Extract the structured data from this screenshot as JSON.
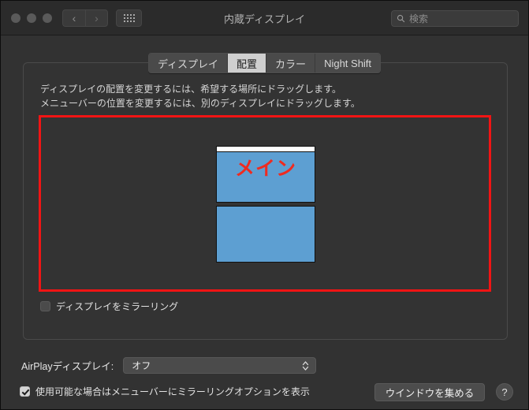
{
  "window": {
    "title": "内蔵ディスプレイ",
    "traffic_lights": [
      "close",
      "minimize",
      "maximize"
    ],
    "nav": {
      "back": "‹",
      "forward": "›"
    },
    "grid_button_icon": "grid-icon"
  },
  "search": {
    "placeholder": "検索",
    "value": "",
    "icon": "search-icon"
  },
  "tabs": [
    {
      "label": "ディスプレイ",
      "selected": false
    },
    {
      "label": "配置",
      "selected": true
    },
    {
      "label": "カラー",
      "selected": false
    },
    {
      "label": "Night Shift",
      "selected": false
    }
  ],
  "instructions": {
    "line1": "ディスプレイの配置を変更するには、希望する場所にドラッグします。",
    "line2": "メニューバーの位置を変更するには、別のディスプレイにドラッグします。"
  },
  "arrangement": {
    "highlight_color": "#f11414",
    "display_color": "#5d9fd2",
    "main_label": "メイン",
    "main_label_color": "#ef2b20",
    "displays": [
      {
        "name": "display-main",
        "has_menubar": true,
        "label": "メイン"
      },
      {
        "name": "display-second",
        "has_menubar": false,
        "label": ""
      }
    ]
  },
  "mirror": {
    "label": "ディスプレイをミラーリング",
    "checked": false
  },
  "airplay": {
    "label": "AirPlayディスプレイ:",
    "value": "オフ"
  },
  "show_mirror_option": {
    "label": "使用可能な場合はメニューバーにミラーリングオプションを表示",
    "checked": true
  },
  "buttons": {
    "gather_windows": "ウインドウを集める",
    "help": "?"
  }
}
